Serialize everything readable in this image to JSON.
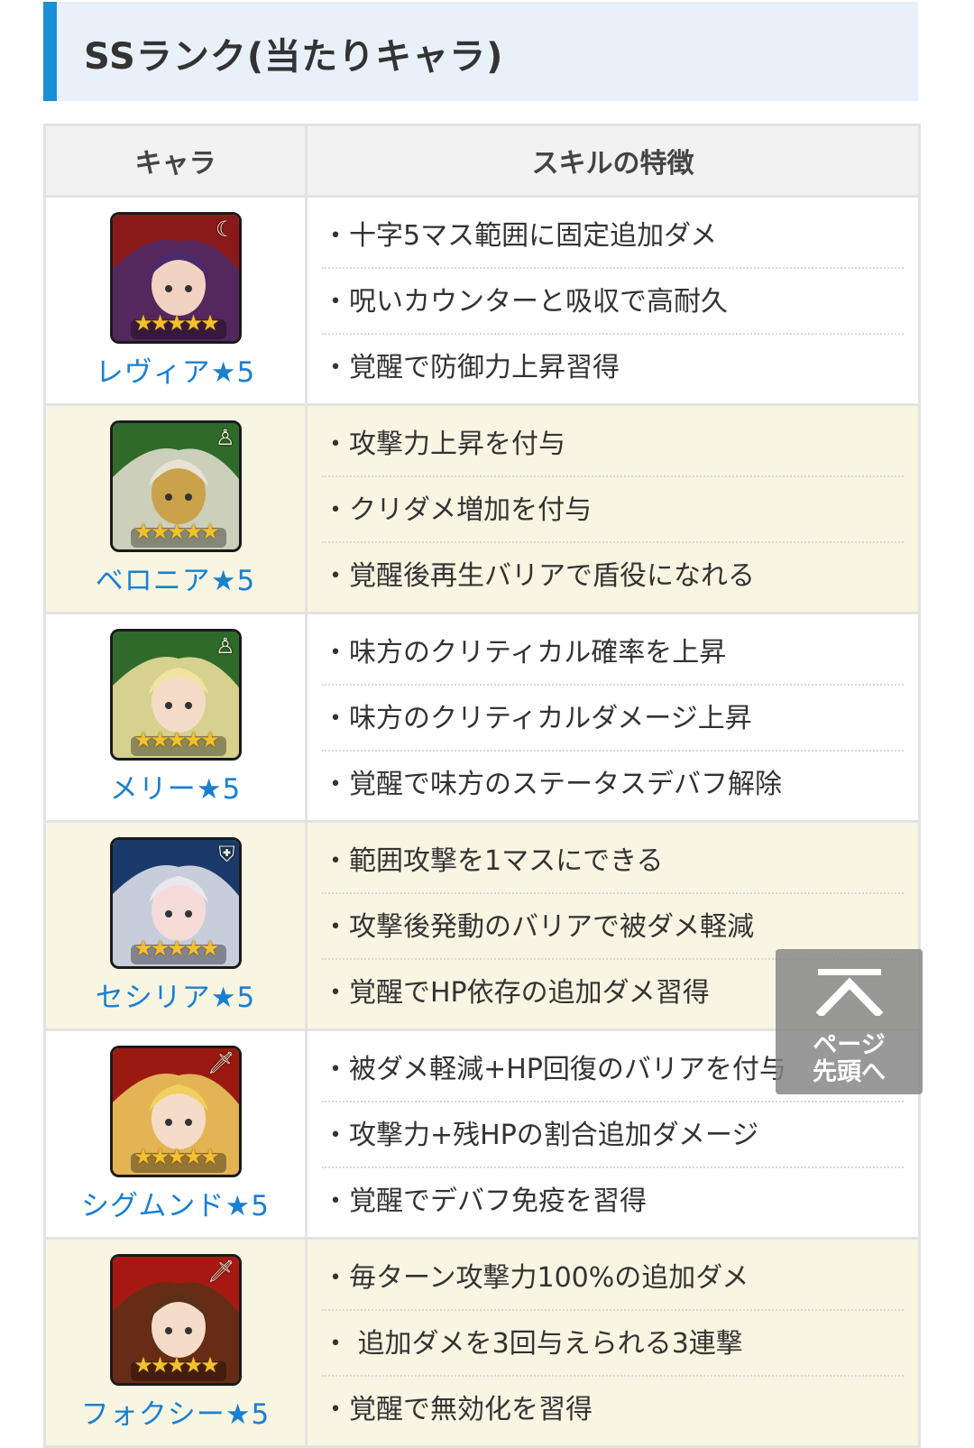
{
  "heading": "SSランク(当たりキャラ)",
  "table": {
    "headers": {
      "character": "キャラ",
      "skills": "スキルの特徴"
    },
    "rows": [
      {
        "name": "レヴィア★5",
        "skills": [
          "十字5マス範囲に固定追加ダメ",
          "呪いカウンターと吸収で高耐久",
          "覚醒で防御力上昇習得"
        ],
        "icon": "demon-icon",
        "colors": {
          "bg": "#8a1a1a",
          "accent": "#4a2a6a",
          "skin": "#f2d2c2"
        }
      },
      {
        "name": "ベロニア★5",
        "skills": [
          "攻撃力上昇を付与",
          "クリダメ増加を付与",
          "覚醒後再生バリアで盾役になれる"
        ],
        "icon": "support-icon",
        "colors": {
          "bg": "#2f6a2a",
          "accent": "#e8e2d4",
          "skin": "#c9a24a"
        }
      },
      {
        "name": "メリー★5",
        "skills": [
          "味方のクリティカル確率を上昇",
          "味方のクリティカルダメージ上昇",
          "覚醒で味方のステータスデバフ解除"
        ],
        "icon": "support-icon",
        "colors": {
          "bg": "#2f6a2a",
          "accent": "#f3e3a0",
          "skin": "#f5dcc8"
        }
      },
      {
        "name": "セシリア★5",
        "skills": [
          "範囲攻撃を1マスにできる",
          "攻撃後発動のバリアで被ダメ軽減",
          "覚醒でHP依存の追加ダメ習得"
        ],
        "icon": "shield-icon",
        "colors": {
          "bg": "#1a3a6a",
          "accent": "#e8e8ee",
          "skin": "#f5dcd8"
        }
      },
      {
        "name": "シグムンド★5",
        "skills": [
          "被ダメ軽減+HP回復のバリアを付与",
          "攻撃力+残HPの割合追加ダメージ",
          "覚醒でデバフ免疫を習得"
        ],
        "icon": "sword-icon",
        "colors": {
          "bg": "#9a1a12",
          "accent": "#f0d060",
          "skin": "#f5dcc8"
        }
      },
      {
        "name": "フォクシー★5",
        "skills": [
          "毎ターン攻撃力100%の追加ダメ",
          " 追加ダメを3回与えられる3連撃",
          "覚醒で無効化を習得"
        ],
        "icon": "sword-icon",
        "colors": {
          "bg": "#a81812",
          "accent": "#5a3018",
          "skin": "#f5dcc8"
        }
      }
    ]
  },
  "back_to_top": {
    "line1": "ページ",
    "line2": "先頭へ"
  }
}
